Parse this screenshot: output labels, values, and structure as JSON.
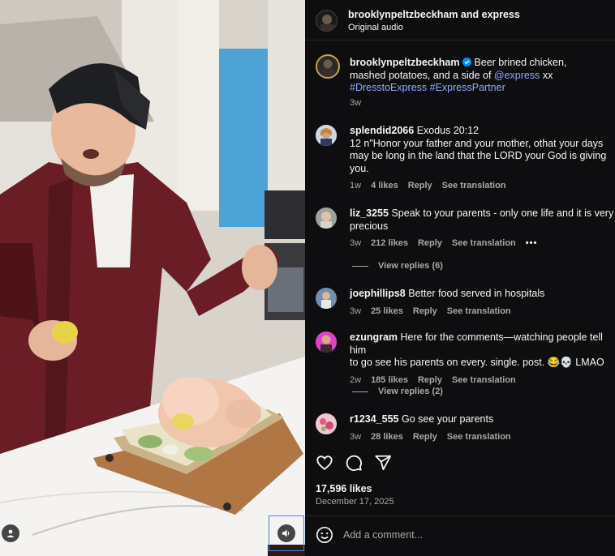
{
  "header": {
    "author": "brooklynpeltzbeckham",
    "conjunction": " and ",
    "collaborator": "express",
    "audio": "Original audio"
  },
  "caption": {
    "author": "brooklynpeltzbeckham",
    "verified_icon": "verified-badge-icon",
    "text_before": "Beer brined chicken, mashed potatoes, and a side of ",
    "mention": "@express",
    "text_after": " xx",
    "hashtags": "#DresstoExpress #ExpressPartner",
    "age": "3w"
  },
  "comments": [
    {
      "user": "splendid2066",
      "text_lines": [
        "Exodus 20:12",
        "12 n\"Honor your father and your mother, othat your days",
        "may be long in the land that the LORD your God is giving",
        "you."
      ],
      "age": "1w",
      "likes": "4 likes",
      "reply": "Reply",
      "translate": "See translation"
    },
    {
      "user": "liz_3255",
      "text_lines": [
        "Speak to your parents - only one life and it is very",
        "precious"
      ],
      "age": "3w",
      "likes": "212 likes",
      "reply": "Reply",
      "translate": "See translation",
      "more_icon": "more-options-icon",
      "replies": "View replies (6)"
    },
    {
      "user": "joephillips8",
      "text_lines": [
        "Better food served in hospitals"
      ],
      "age": "3w",
      "likes": "25 likes",
      "reply": "Reply",
      "translate": "See translation"
    },
    {
      "user": "ezungram",
      "text_lines": [
        "Here for the comments—watching people tell him",
        "to go see his parents on every. single. post. 😂💀 LMAO"
      ],
      "age": "2w",
      "likes": "185 likes",
      "reply": "Reply",
      "translate": "See translation",
      "replies": "View replies (2)"
    },
    {
      "user": "r1234_555",
      "text_lines": [
        "Go see your parents"
      ],
      "age": "3w",
      "likes": "28 likes",
      "reply": "Reply",
      "translate": "See translation"
    }
  ],
  "actions": {
    "like_icon": "heart-icon",
    "comment_icon": "comment-icon",
    "share_icon": "share-icon"
  },
  "likes_total": "17,596 likes",
  "post_date": "December 17, 2025",
  "comment_box": {
    "emoji_icon": "emoji-icon",
    "placeholder": "Add a comment..."
  },
  "video": {
    "user_tag_icon": "user-tag-icon",
    "mute_icon": "speaker-icon"
  },
  "colors": {
    "panel_bg": "#0e0e10",
    "link": "#8ea9ff",
    "verified": "#0095f6",
    "muted_text": "#a8a8a8"
  }
}
